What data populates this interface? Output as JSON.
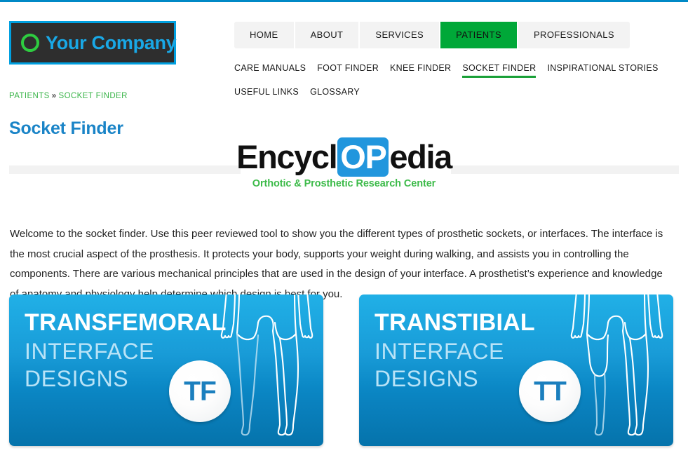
{
  "site": {
    "logo": {
      "text": "Your Company",
      "icon": "circle-ring-icon"
    },
    "top_rule_color": "#0089c6"
  },
  "main_nav": {
    "items": [
      {
        "label": "HOME",
        "active": false
      },
      {
        "label": "ABOUT",
        "active": false
      },
      {
        "label": "SERVICES",
        "active": false
      },
      {
        "label": "PATIENTS",
        "active": true
      },
      {
        "label": "PROFESSIONALS",
        "active": false
      }
    ],
    "active_color": "#00a838",
    "inactive_background": "#f3f3f3"
  },
  "sub_nav": {
    "items": [
      {
        "label": "CARE MANUALS",
        "active": false
      },
      {
        "label": "FOOT FINDER",
        "active": false
      },
      {
        "label": "KNEE FINDER",
        "active": false
      },
      {
        "label": "SOCKET FINDER",
        "active": true
      },
      {
        "label": "INSPIRATIONAL STORIES",
        "active": false
      },
      {
        "label": "USEFUL LINKS",
        "active": false
      },
      {
        "label": "GLOSSARY",
        "active": false
      }
    ],
    "underline_color": "#19a037"
  },
  "breadcrumb": {
    "parent": "PATIENTS",
    "separator": "»",
    "current": "SOCKET FINDER",
    "color": "#3bb54a"
  },
  "page_title": {
    "text": "Socket Finder",
    "color": "#1a84c7"
  },
  "encyclopedia_banner": {
    "part1": "Encycl",
    "highlight": "OP",
    "part2": "edia",
    "subtitle": "Orthotic & Prosthetic Research Center",
    "highlight_background": "#2196dd",
    "subtitle_color": "#3dbb4a"
  },
  "intro": {
    "paragraph": "Welcome to the socket finder. Use this peer reviewed tool to show you the different types of prosthetic sockets, or interfaces. The interface is the most crucial aspect of the prosthesis. It protects your body, supports your weight during walking, and assists you in controlling the components. There are various mechanical principles that are used in the design of your interface. A prosthetist’s experience and knowledge of anatomy and physiology help determine which design is best for you."
  },
  "cards": [
    {
      "headline": "TRANSFEMORAL",
      "sub_line1": "INTERFACE",
      "sub_line2": "DESIGNS",
      "badge": "TF",
      "illustration": "transfemoral-legs-outline-icon",
      "accent": "#00a4e3"
    },
    {
      "headline": "TRANSTIBIAL",
      "sub_line1": "INTERFACE",
      "sub_line2": "DESIGNS",
      "badge": "TT",
      "illustration": "transtibial-legs-outline-icon",
      "accent": "#00a4e3"
    }
  ]
}
